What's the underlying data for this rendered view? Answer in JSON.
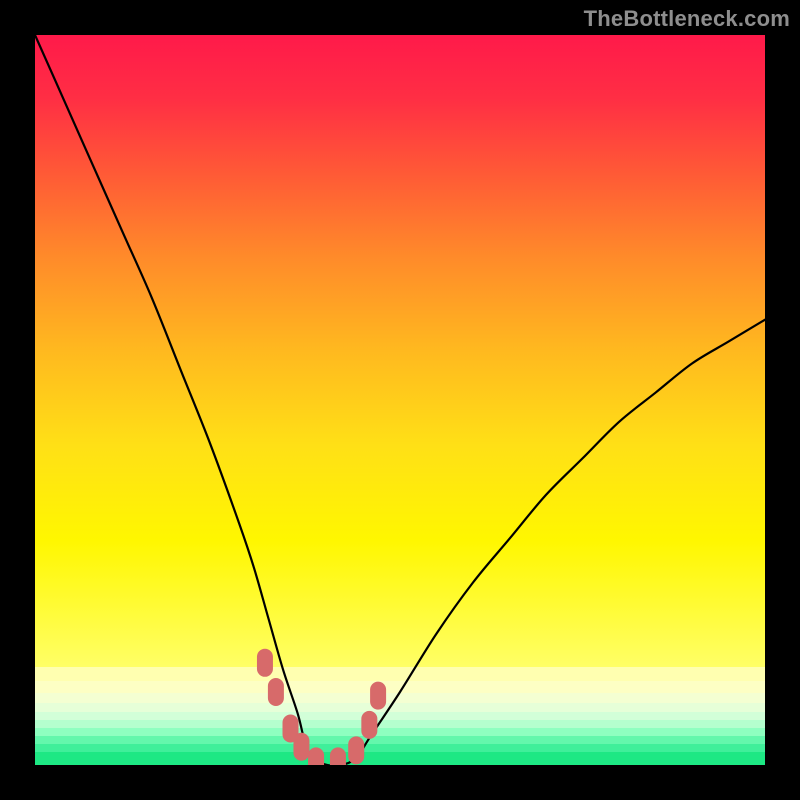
{
  "watermark": {
    "text": "TheBottleneck.com"
  },
  "colors": {
    "black": "#000000",
    "curve": "#000000",
    "marker": "#d76a6a",
    "marker_stroke": "#b94f4f"
  },
  "chart_data": {
    "type": "line",
    "title": "",
    "xlabel": "",
    "ylabel": "",
    "xlim": [
      0,
      100
    ],
    "ylim": [
      0,
      100
    ],
    "legend": false,
    "grid": false,
    "background": "rainbow-vertical-gradient",
    "note": "V-shaped bottleneck curve; x in percent of plot width, y in percent of plot height (0 = bottom).",
    "series": [
      {
        "name": "bottleneck-curve",
        "x": [
          0,
          4,
          8,
          12,
          16,
          20,
          24,
          28,
          30,
          32,
          34,
          36,
          37,
          38,
          40,
          42,
          44,
          46,
          50,
          55,
          60,
          65,
          70,
          75,
          80,
          85,
          90,
          95,
          100
        ],
        "y": [
          100,
          91,
          82,
          73,
          64,
          54,
          44,
          33,
          27,
          20,
          13,
          7,
          3,
          1,
          0,
          0,
          1,
          4,
          10,
          18,
          25,
          31,
          37,
          42,
          47,
          51,
          55,
          58,
          61
        ]
      }
    ],
    "markers": {
      "name": "floor-markers",
      "shape": "rounded-cap",
      "color": "#d76a6a",
      "x": [
        31.5,
        33.0,
        35.0,
        36.5,
        38.5,
        41.5,
        44.0,
        45.8,
        47.0
      ],
      "y": [
        14.0,
        10.0,
        5.0,
        2.5,
        0.5,
        0.5,
        2.0,
        5.5,
        9.5
      ]
    }
  }
}
